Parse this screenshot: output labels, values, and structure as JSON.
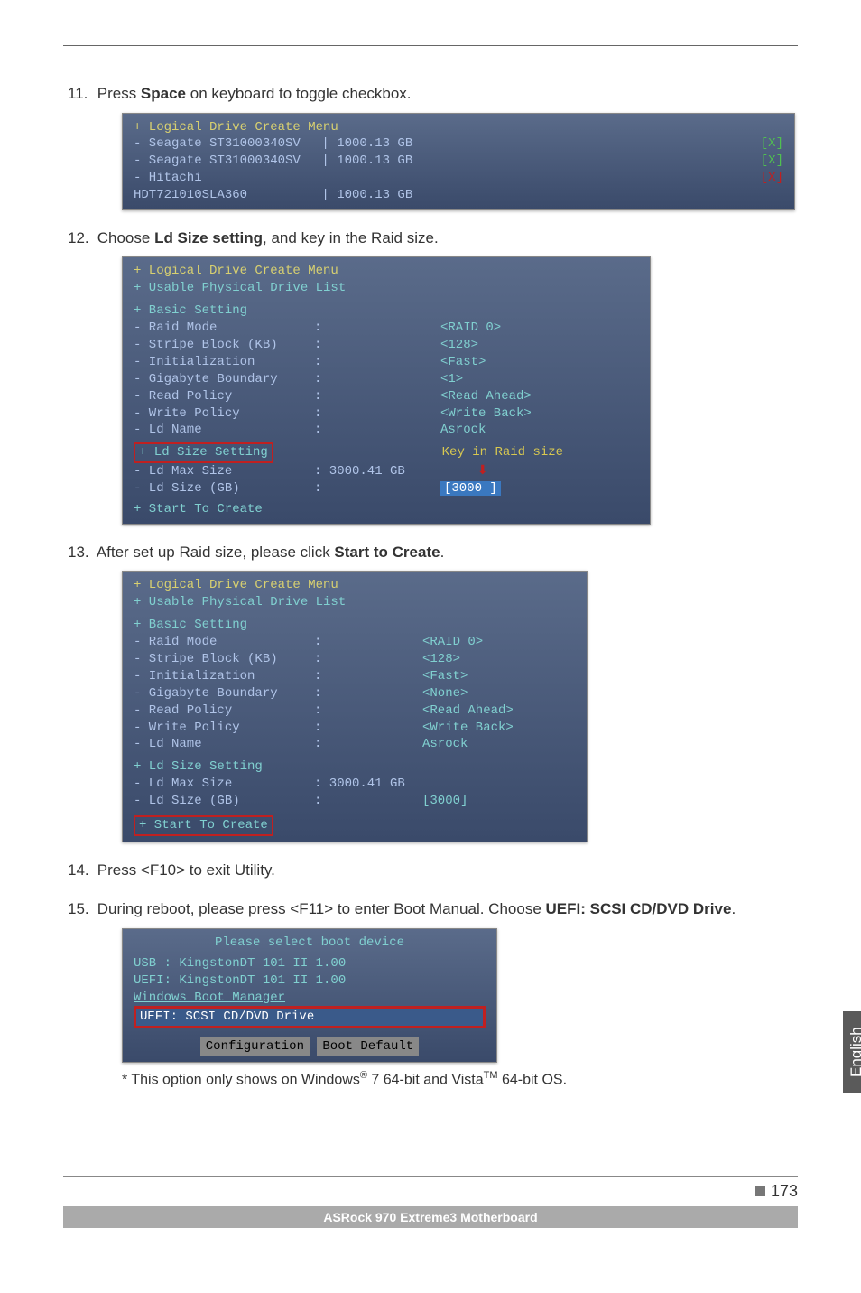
{
  "steps": {
    "s11": {
      "num": "11.",
      "text_a": "Press ",
      "bold": "Space",
      "text_b": " on keyboard to toggle checkbox."
    },
    "s12": {
      "num": "12.",
      "text_a": "Choose ",
      "bold": "Ld Size setting",
      "text_b": ", and key in the Raid size."
    },
    "s13": {
      "num": "13.",
      "text_a": "After set up Raid size, please click ",
      "bold": "Start to Create",
      "text_b": "."
    },
    "s14": {
      "num": "14.",
      "text": "Press <F10> to exit Utility."
    },
    "s15": {
      "num": "15.",
      "text_a": "During reboot, please press <F11> to enter Boot Manual. Choose ",
      "bold": "UEFI: SCSI CD/DVD Drive",
      "text_b": "."
    }
  },
  "bios11": {
    "header": "+ Logical Drive Create Menu",
    "drives": [
      {
        "name": "- Seagate ST31000340SV",
        "size": "| 1000.13 GB",
        "chk": "[X]"
      },
      {
        "name": "- Seagate ST31000340SV",
        "size": "| 1000.13 GB",
        "chk": "[X]"
      },
      {
        "name": "- Hitachi HDT721010SLA360",
        "size": "| 1000.13 GB",
        "chk": "[X]",
        "filled": true
      }
    ]
  },
  "bios12": {
    "header": "+ Logical Drive Create Menu",
    "sub": "+ Usable Physical Drive List",
    "section1": "+ Basic Setting",
    "rows": [
      {
        "label": "- Raid Mode",
        "sep": ":",
        "val": "<RAID 0>"
      },
      {
        "label": "- Stripe Block (KB)",
        "sep": ":",
        "val": "<128>"
      },
      {
        "label": "- Initialization",
        "sep": ":",
        "val": "<Fast>"
      },
      {
        "label": "- Gigabyte Boundary",
        "sep": ":",
        "val": "<1>"
      },
      {
        "label": "- Read Policy",
        "sep": ":",
        "val": "<Read Ahead>"
      },
      {
        "label": "- Write Policy",
        "sep": ":",
        "val": "<Write Back>"
      },
      {
        "label": "- Ld Name",
        "sep": ":",
        "val": "Asrock"
      }
    ],
    "ld_section": "+ Ld Size Setting",
    "ld_note": "Key in Raid size",
    "ld_max": {
      "label": "- Ld Max Size",
      "val": ": 3000.41 GB"
    },
    "ld_size": {
      "label": "- Ld Size (GB)",
      "sep": ":",
      "val": "[3000    ]"
    },
    "start": "+ Start To Create"
  },
  "bios13": {
    "header": "+ Logical Drive Create Menu",
    "sub": "+ Usable Physical Drive List",
    "section1": "+ Basic Setting",
    "rows": [
      {
        "label": "- Raid Mode",
        "sep": ":",
        "val": "<RAID 0>"
      },
      {
        "label": "- Stripe Block (KB)",
        "sep": ":",
        "val": "<128>"
      },
      {
        "label": "- Initialization",
        "sep": ":",
        "val": "<Fast>"
      },
      {
        "label": "- Gigabyte Boundary",
        "sep": ":",
        "val": "<None>"
      },
      {
        "label": "- Read Policy",
        "sep": ":",
        "val": "<Read Ahead>"
      },
      {
        "label": "- Write Policy",
        "sep": ":",
        "val": "<Write Back>"
      },
      {
        "label": "- Ld Name",
        "sep": ":",
        "val": "Asrock"
      }
    ],
    "ld_section": "+ Ld Size Setting",
    "ld_max": {
      "label": "- Ld Max Size",
      "val": ": 3000.41 GB"
    },
    "ld_size": {
      "label": "- Ld Size (GB)",
      "sep": ":",
      "val": "[3000]"
    },
    "start": "+ Start To Create"
  },
  "bios15": {
    "title": "Please select boot device",
    "items": [
      "USB : KingstonDT 101 II 1.00",
      "UEFI: KingstonDT 101 II 1.00",
      "Windows Boot Manager",
      "UEFI: SCSI CD/DVD Drive"
    ],
    "btn1": "Configuration",
    "btn2": "Boot Default"
  },
  "footnote": {
    "a": "* This option only shows on Windows",
    "r": "®",
    "b": " 7 64-bit and Vista",
    "tm": "TM",
    "c": " 64-bit OS."
  },
  "side": "English",
  "page_num": "173",
  "footer": "ASRock  970 Extreme3  Motherboard"
}
